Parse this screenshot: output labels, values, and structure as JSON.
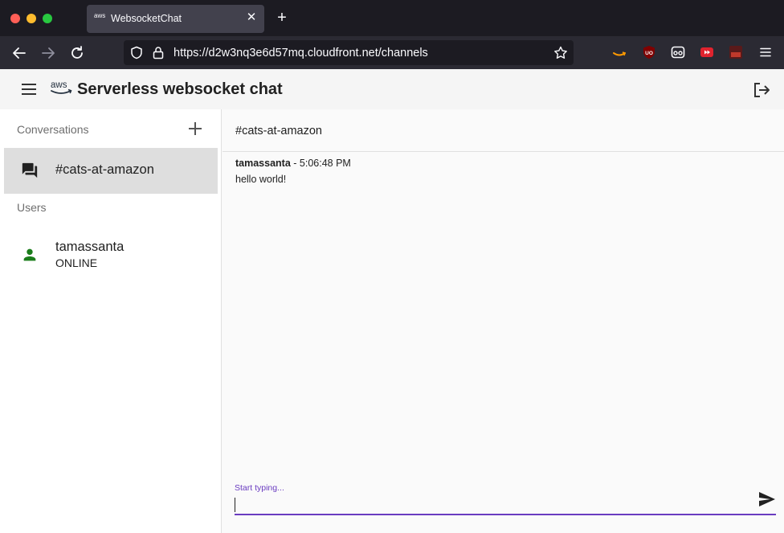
{
  "browser": {
    "tab_title": "WebsocketChat",
    "tab_favicon_text": "aws",
    "url": "https://d2w3nq3e6d57mq.cloudfront.net/channels"
  },
  "app": {
    "title": "Serverless websocket chat",
    "accent_color": "#6a3cc0",
    "online_color": "#1b7d1b"
  },
  "sidebar": {
    "conversations_heading": "Conversations",
    "conversations": [
      {
        "label": "#cats-at-amazon",
        "selected": true
      }
    ],
    "users_heading": "Users",
    "users": [
      {
        "name": "tamassanta",
        "status": "ONLINE"
      }
    ]
  },
  "channel": {
    "title": "#cats-at-amazon",
    "messages": [
      {
        "author": "tamassanta",
        "time_suffix": " - 5:06:48 PM",
        "text": "hello world!"
      }
    ]
  },
  "composer": {
    "label": "Start typing...",
    "value": ""
  }
}
